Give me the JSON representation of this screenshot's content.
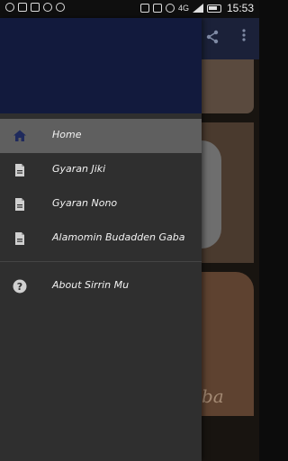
{
  "status_bar": {
    "time": "15:53",
    "network": "4G",
    "left_icons": [
      "whatsapp-icon",
      "image-icon",
      "qr-icon",
      "record-icon",
      "circle-icon"
    ],
    "right_icons": [
      "sim-icon",
      "no-sim-icon",
      "alarm-icon",
      "signal-icon",
      "battery-icon"
    ]
  },
  "drawer": {
    "items": [
      {
        "label": "Home",
        "icon": "home-icon",
        "active": true
      },
      {
        "label": "Gyaran Jiki",
        "icon": "document-icon",
        "active": false
      },
      {
        "label": "Gyaran Nono",
        "icon": "document-icon",
        "active": false
      },
      {
        "label": "Alamomin Budadden Gaba",
        "icon": "document-icon",
        "active": false
      }
    ],
    "secondary_items": [
      {
        "label": "About Sirrin Mu",
        "icon": "help-icon"
      }
    ]
  },
  "background_app": {
    "toolbar_icons": [
      "share-icon",
      "more-vert-icon"
    ],
    "card3_text": "ba"
  },
  "colors": {
    "drawer_header": "#121a3d",
    "drawer_bg": "#2f2f2f",
    "active_item": "#5f5f5f",
    "home_icon": "#1f2a5c",
    "document_icon": "#d0d0d0"
  }
}
